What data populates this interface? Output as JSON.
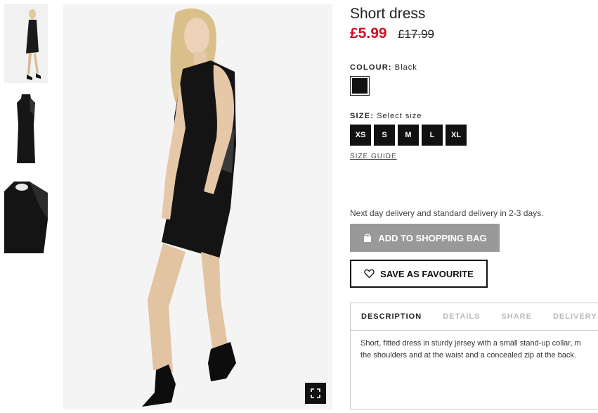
{
  "gallery": {
    "thumbnails": [
      {
        "alt": "model-front-view"
      },
      {
        "alt": "dress-flat-view"
      },
      {
        "alt": "dress-detail-view"
      }
    ],
    "expand_icon": "expand-icon"
  },
  "product": {
    "title": "Short dress",
    "price_now": "£5.99",
    "price_old": "£17.99",
    "colour_label": "COLOUR:",
    "colour_value": "Black",
    "colour_swatch": "#111111",
    "size_label": "SIZE:",
    "size_value": "Select size",
    "sizes": [
      "XS",
      "S",
      "M",
      "L",
      "XL"
    ],
    "size_guide": "SIZE GUIDE",
    "delivery_note": "Next day delivery and standard delivery in 2-3 days.",
    "add_to_bag": "ADD TO SHOPPING BAG",
    "save_favourite": "SAVE AS FAVOURITE"
  },
  "tabs": {
    "items": [
      "DESCRIPTION",
      "DETAILS",
      "SHARE",
      "DELIVERY"
    ],
    "active": "DESCRIPTION",
    "description_line1": "Short, fitted dress in sturdy jersey with a small stand-up collar, m",
    "description_line2": "the shoulders and at the waist and a concealed zip at the back."
  },
  "colors": {
    "sale_red": "#d0112b",
    "add_button": "#999999"
  }
}
